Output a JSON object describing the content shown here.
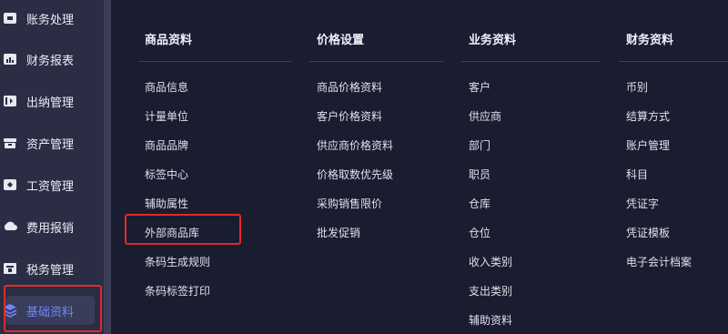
{
  "sidebar": {
    "items": [
      {
        "label": "账务处理",
        "icon": "ledger-icon"
      },
      {
        "label": "财务报表",
        "icon": "report-icon"
      },
      {
        "label": "出纳管理",
        "icon": "cashier-icon"
      },
      {
        "label": "资产管理",
        "icon": "asset-icon"
      },
      {
        "label": "工资管理",
        "icon": "salary-icon"
      },
      {
        "label": "费用报销",
        "icon": "expense-icon"
      },
      {
        "label": "税务管理",
        "icon": "tax-icon"
      },
      {
        "label": "基础资料",
        "icon": "layers-icon",
        "active": true
      }
    ]
  },
  "columns": [
    {
      "title": "商品资料",
      "items": [
        "商品信息",
        "计量单位",
        "商品品牌",
        "标签中心",
        "辅助属性",
        "外部商品库",
        "条码生成规则",
        "条码标签打印"
      ]
    },
    {
      "title": "价格设置",
      "items": [
        "商品价格资料",
        "客户价格资料",
        "供应商价格资料",
        "价格取数优先级",
        "采购销售限价",
        "批发促销"
      ]
    },
    {
      "title": "业务资料",
      "items": [
        "客户",
        "供应商",
        "部门",
        "职员",
        "仓库",
        "仓位",
        "收入类别",
        "支出类别",
        "辅助资料"
      ]
    },
    {
      "title": "财务资料",
      "items": [
        "币别",
        "结算方式",
        "账户管理",
        "科目",
        "凭证字",
        "凭证模板",
        "电子会计档案"
      ]
    }
  ],
  "colors": {
    "background": "#1a1c30",
    "sidebar": "#2a2d44",
    "active_text": "#6c86ff",
    "highlight_border": "#e12a2a"
  }
}
